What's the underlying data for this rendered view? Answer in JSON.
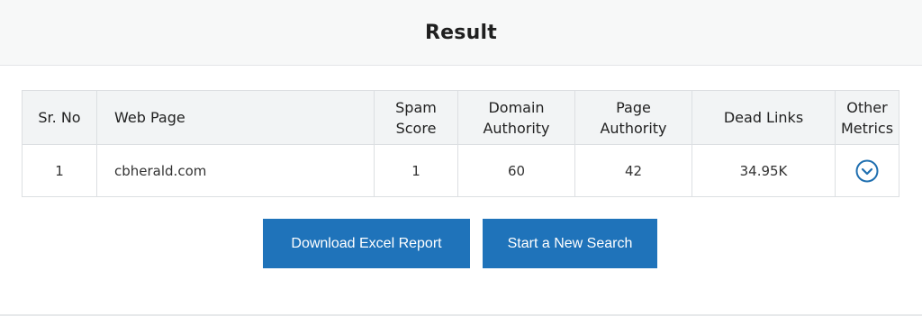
{
  "header": {
    "title": "Result"
  },
  "table": {
    "columns": {
      "sr_no": "Sr. No",
      "web_page": "Web Page",
      "spam_score": {
        "line1": "Spam",
        "line2": "Score"
      },
      "domain_authority": {
        "line1": "Domain",
        "line2": "Authority"
      },
      "page_authority": {
        "line1": "Page",
        "line2": "Authority"
      },
      "dead_links": "Dead Links",
      "other_metrics": {
        "line1": "Other",
        "line2": "Metrics"
      }
    },
    "rows": [
      {
        "sr_no": "1",
        "web_page": "cbherald.com",
        "spam_score": "1",
        "domain_authority": "60",
        "page_authority": "42",
        "dead_links": "34.95K",
        "other_metrics_icon": "chevron-down-circle-icon"
      }
    ]
  },
  "buttons": {
    "download": "Download Excel Report",
    "new_search": "Start a New Search"
  },
  "colors": {
    "button_bg": "#1f73ba",
    "icon": "#1f6fb0",
    "header_bg": "#f7f8f8"
  }
}
